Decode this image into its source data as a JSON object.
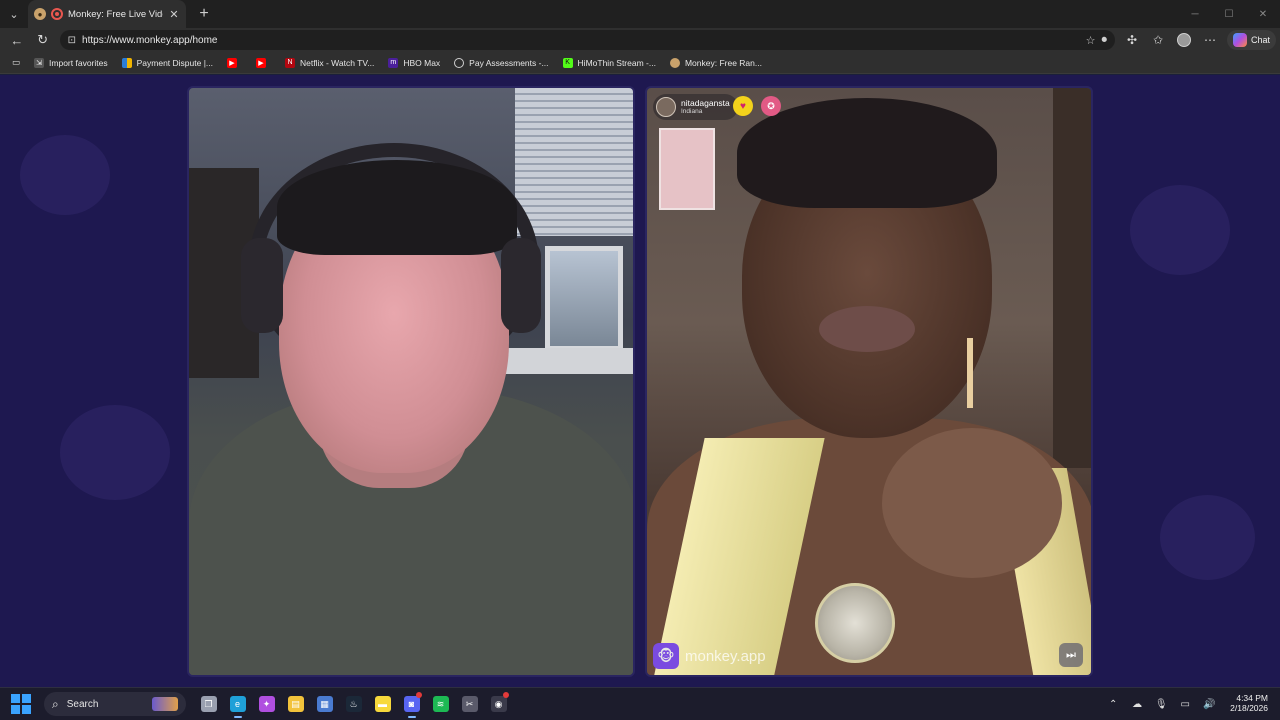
{
  "browser": {
    "tab": {
      "title": "Monkey: Free Live Video Chat",
      "close": "✕"
    },
    "new_tab": "+",
    "window_controls": {
      "minimize": "─",
      "maximize": "☐",
      "close": "✕"
    },
    "url": "https://www.monkey.app/home",
    "chat_label": "Chat",
    "bookmarks": [
      {
        "label": "Import favorites",
        "icon": "import-icon",
        "color": "#9a9a9a"
      },
      {
        "label": "Payment Dispute |...",
        "icon": "payment-icon",
        "color": "#f0b400"
      },
      {
        "label": "",
        "icon": "youtube-icon",
        "color": "#ff0000"
      },
      {
        "label": "",
        "icon": "youtube-icon",
        "color": "#ff0000"
      },
      {
        "label": "Netflix - Watch TV...",
        "icon": "netflix-icon",
        "color": "#e50914"
      },
      {
        "label": "HBO Max",
        "icon": "hbo-icon",
        "color": "#5822b4"
      },
      {
        "label": "Pay Assessments -...",
        "icon": "globe-icon",
        "color": "#9a9a9a"
      },
      {
        "label": "HiMoThin Stream -...",
        "icon": "kick-icon",
        "color": "#53fc18"
      },
      {
        "label": "Monkey: Free Ran...",
        "icon": "monkey-icon",
        "color": "#c9a26b"
      }
    ]
  },
  "remote_user": {
    "username": "nitadagansta",
    "location": "Indiana"
  },
  "watermark": "monkey.app",
  "taskbar": {
    "search_placeholder": "Search",
    "apps": [
      {
        "name": "task-view-icon",
        "color": "#9aa0b0",
        "glyph": "❐"
      },
      {
        "name": "edge-icon",
        "color": "#1fa0d8",
        "glyph": "e",
        "active": true
      },
      {
        "name": "copilot-icon",
        "color": "#b04fe0",
        "glyph": "✦"
      },
      {
        "name": "file-explorer-icon",
        "color": "#f2c23b",
        "glyph": "▤"
      },
      {
        "name": "store-icon",
        "color": "#4a7bd0",
        "glyph": "▦"
      },
      {
        "name": "steam-icon",
        "color": "#1b2838",
        "glyph": "♨"
      },
      {
        "name": "sticky-notes-icon",
        "color": "#f7d93c",
        "glyph": "▬"
      },
      {
        "name": "discord-icon",
        "color": "#5865f2",
        "glyph": "◙",
        "active": true,
        "badge": true
      },
      {
        "name": "spotify-icon",
        "color": "#1db954",
        "glyph": "≋"
      },
      {
        "name": "snipping-tool-icon",
        "color": "#5a5a6a",
        "glyph": "✂"
      },
      {
        "name": "obs-icon",
        "color": "#3a3a4a",
        "glyph": "◉",
        "badge": true
      }
    ],
    "time": "4:34 PM",
    "date": "2/18/2026"
  }
}
